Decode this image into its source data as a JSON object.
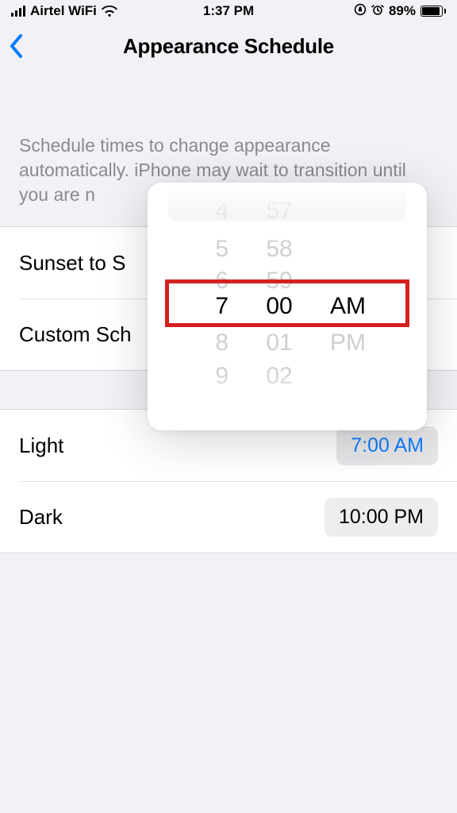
{
  "status": {
    "carrier": "Airtel WiFi",
    "time": "1:37 PM",
    "battery_pct": "89%"
  },
  "nav": {
    "title": "Appearance Schedule"
  },
  "description": "Schedule times to change appearance automatically. iPhone may wait to transition until you are n",
  "options": {
    "sunset_label": "Sunset to S",
    "custom_label": "Custom Sch"
  },
  "schedule": {
    "light_label": "Light",
    "light_time": "7:00 AM",
    "dark_label": "Dark",
    "dark_time": "10:00 PM"
  },
  "picker": {
    "hours": [
      "4",
      "5",
      "6",
      "7",
      "8",
      "9"
    ],
    "minutes": [
      "57",
      "58",
      "59",
      "00",
      "01",
      "02"
    ],
    "ampm": [
      "AM",
      "PM"
    ],
    "selected": {
      "hour": "7",
      "minute": "00",
      "ampm": "AM"
    }
  }
}
